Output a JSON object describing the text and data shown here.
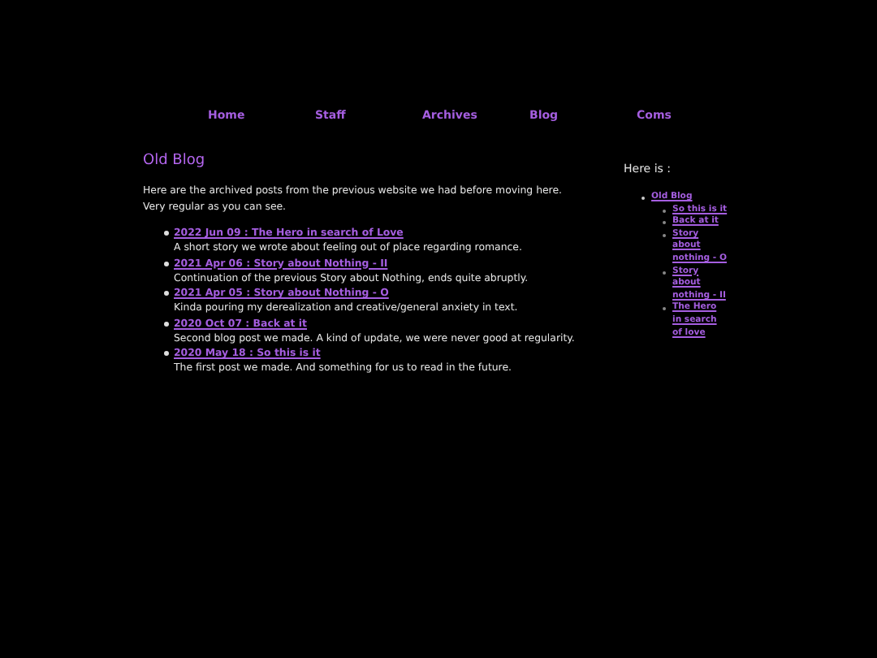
{
  "nav": [
    {
      "label": "Home"
    },
    {
      "label": "Staff"
    },
    {
      "label": "Archives"
    },
    {
      "label": "Blog"
    },
    {
      "label": "Coms"
    }
  ],
  "main": {
    "title": "Old Blog",
    "intro": "Here are the archived posts from the previous website we had before moving here. Very regular as you can see.",
    "posts": [
      {
        "link": "2022 Jun 09 : The Hero in search of Love",
        "summary": "A short story we wrote about feeling out of place regarding romance."
      },
      {
        "link": "2021 Apr 06 : Story about Nothing - II",
        "summary": "Continuation of the previous Story about Nothing, ends quite abruptly."
      },
      {
        "link": "2021 Apr 05 : Story about Nothing - O",
        "summary": "Kinda pouring my derealization and creative/general anxiety in text."
      },
      {
        "link": "2020 Oct 07 : Back at it",
        "summary": "Second blog post we made. A kind of update, we were never good at regularity."
      },
      {
        "link": "2020 May 18 : So this is it",
        "summary": "The first post we made. And something for us to read in the future."
      }
    ]
  },
  "sidebar": {
    "title": "Here is :",
    "items": [
      {
        "label": "Old Blog",
        "children": [
          {
            "label": "So this is it"
          },
          {
            "label": "Back at it"
          },
          {
            "label": "Story about nothing - O"
          },
          {
            "label": "Story about nothing - II"
          },
          {
            "label": "The Hero in search of love"
          }
        ]
      }
    ]
  }
}
